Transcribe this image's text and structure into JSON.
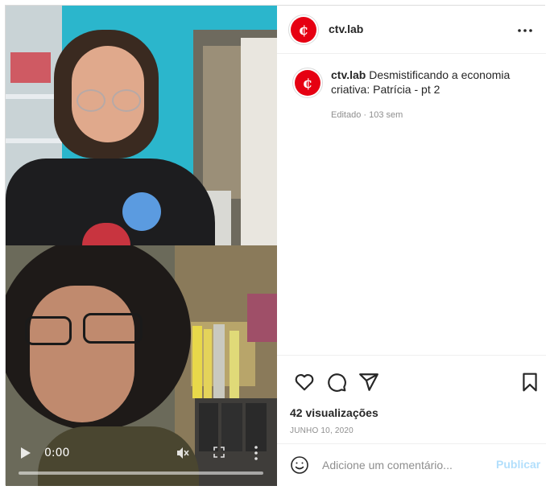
{
  "post": {
    "account": "ctv.lab",
    "avatar_glyph": "¢",
    "caption_user": "ctv.lab",
    "caption_text": "Desmistificando a economia criativa: Patrícia - pt 2",
    "meta": "Editado · 103 sem",
    "views": "42 visualizações",
    "date": "JUNHO 10, 2020"
  },
  "video": {
    "time": "0:00",
    "progress": 0
  },
  "actions": {
    "icons": [
      "heart-icon",
      "comment-icon",
      "share-icon",
      "bookmark-icon"
    ]
  },
  "comment": {
    "placeholder": "Adicione um comentário...",
    "publish_label": "Publicar"
  },
  "colors": {
    "brand": "#e60012",
    "publish_disabled": "#b2dffc",
    "muted": "#8e8e8e"
  }
}
